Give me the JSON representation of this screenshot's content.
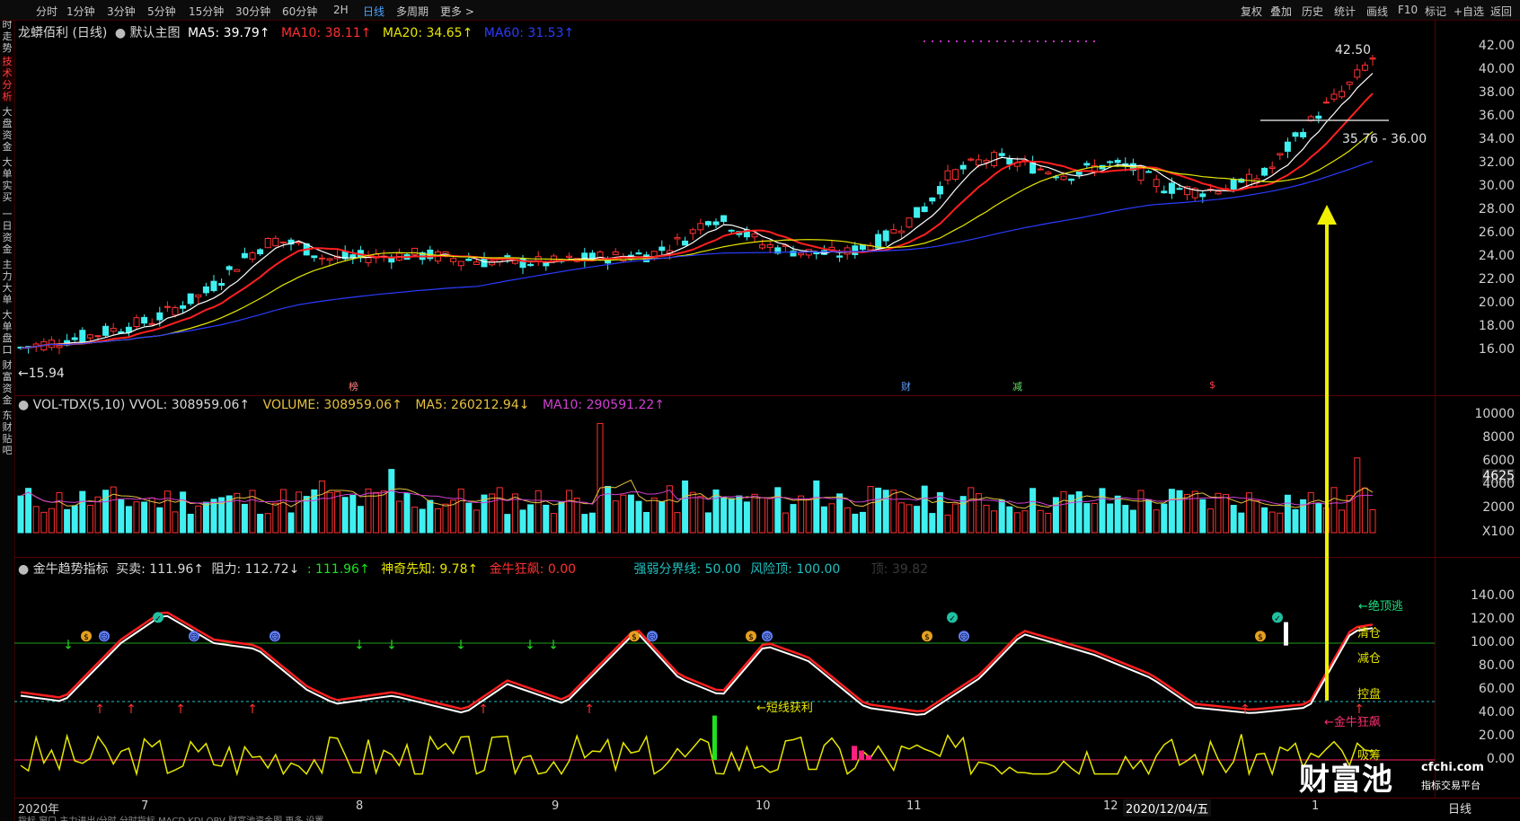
{
  "toolbar": {
    "left": [
      "分时",
      "1分钟",
      "3分钟",
      "5分钟",
      "15分钟",
      "30分钟",
      "60分钟",
      "2H",
      "日线",
      "多周期",
      "更多 >"
    ],
    "active": "日线",
    "right": [
      "复权",
      "叠加",
      "历史",
      "统计",
      "画线",
      "F10",
      "标记",
      "+自选",
      "返回"
    ]
  },
  "left_tabs": [
    {
      "label": "分时走势",
      "active": false
    },
    {
      "label": "技术分析",
      "active": true
    },
    {
      "label": "大盘资金",
      "active": false
    },
    {
      "label": "大单实买",
      "active": false
    },
    {
      "label": "一日资金",
      "active": false
    },
    {
      "label": "主力大单",
      "active": false
    },
    {
      "label": "大单盘口",
      "active": false
    },
    {
      "label": "财富资金",
      "active": false
    },
    {
      "label": "东财贴吧",
      "active": false
    }
  ],
  "main": {
    "title": "龙蟒佰利 (日线)",
    "subtitle": "默认主图",
    "ma5": "MA5: 39.79↑",
    "ma10": "MA10: 38.11↑",
    "ma20": "MA20: 34.65↑",
    "ma60": "MA60: 31.53↑",
    "colors": {
      "ma5": "#ffffff",
      "ma10": "#ff3030",
      "ma20": "#e6e600",
      "ma60": "#2a3cff"
    },
    "price_axis": [
      "42.00",
      "40.00",
      "38.00",
      "36.00",
      "34.00",
      "32.00",
      "30.00",
      "28.00",
      "26.00",
      "24.00",
      "22.00",
      "20.00",
      "18.00",
      "16.00"
    ],
    "high_label": "42.50",
    "low_label": "15.94",
    "range_label": "35.76 - 36.00",
    "markers": [
      "榜",
      "财",
      "减",
      "$"
    ]
  },
  "volume": {
    "title": "VOL-TDX(5,10)",
    "vvol": "VVOL: 308959.06↑",
    "volume": "VOLUME: 308959.06↑",
    "ma5": "MA5: 260212.94↓",
    "ma10": "MA10: 290591.22↑",
    "axis": [
      "10000",
      "8000",
      "6000",
      "4625",
      "4000",
      "2000",
      "X100"
    ]
  },
  "indicator": {
    "title": "金牛趋势指标",
    "buysell": "买卖: 111.96↑",
    "resist": "阻力: 112.72↓",
    "value": ": 111.96↑",
    "prophet": "神奇先知: 9.78↑",
    "crazy": "金牛狂飙: 0.00",
    "boundary": "强弱分界线: 50.00",
    "risk": "风险顶: 100.00",
    "extra": "顶: 39.82",
    "axis": [
      "140.00",
      "120.00",
      "100.00",
      "80.00",
      "60.00",
      "40.00",
      "20.00",
      "0.00"
    ],
    "labels": {
      "clear": "清仓",
      "reduce": "减仓",
      "control": "控盘",
      "absorb": "吸筹"
    },
    "annot_escape": "←绝顶逃",
    "annot_short": "←短线获利",
    "annot_crazy": "←金牛狂飙"
  },
  "dates": [
    "2020年",
    "7",
    "8",
    "9",
    "10",
    "11",
    "12",
    "2020/12/04/五",
    "1"
  ],
  "period": "日线",
  "bottom_tabs": "指标 窗口 主力进出/分时 分时指标 MACD KDJ OBV 财富池资金图 更多 设置",
  "watermark": {
    "brand": "财富池",
    "site": "cfchi.com",
    "slogan": "指标交易平台"
  }
}
